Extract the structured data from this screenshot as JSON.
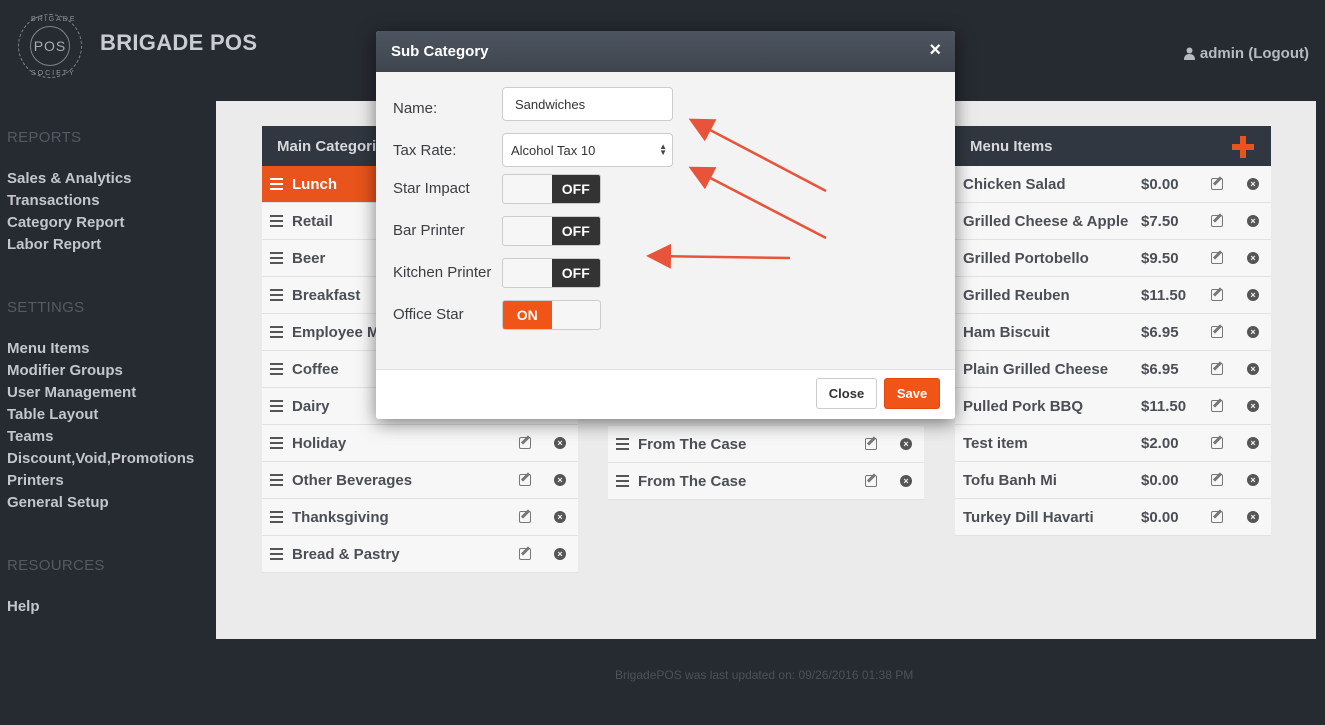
{
  "header": {
    "logo_text": "POS",
    "logo_ring_top": "BRIGADE",
    "logo_ring_bottom": "SOCIETY",
    "brand": "BRIGADE POS",
    "user": "admin (Logout)"
  },
  "sidebar": {
    "reports_title": "REPORTS",
    "reports": [
      "Sales & Analytics",
      "Transactions",
      "Category Report",
      "Labor Report"
    ],
    "settings_title": "SETTINGS",
    "settings": [
      "Menu Items",
      "Modifier Groups",
      "User Management",
      "Table Layout",
      "Teams",
      "Discount,Void,Promotions",
      "Printers",
      "General Setup"
    ],
    "resources_title": "RESOURCES",
    "resources": [
      "Help"
    ]
  },
  "main_categories": {
    "title": "Main Categories",
    "items": [
      "Lunch",
      "Retail",
      "Beer",
      "Breakfast",
      "Employee M",
      "Coffee",
      "Dairy",
      "Holiday",
      "Other Beverages",
      "Thanksgiving",
      "Bread & Pastry"
    ],
    "active_index": 0
  },
  "sub_categories": {
    "items": [
      "From The Case",
      "From The Case"
    ]
  },
  "menu_items": {
    "title": "Menu Items",
    "items": [
      {
        "name": "Chicken Salad",
        "price": "$0.00"
      },
      {
        "name": "Grilled Cheese & Apple",
        "price": "$7.50"
      },
      {
        "name": "Grilled Portobello",
        "price": "$9.50"
      },
      {
        "name": "Grilled Reuben",
        "price": "$11.50"
      },
      {
        "name": "Ham Biscuit",
        "price": "$6.95"
      },
      {
        "name": "Plain Grilled Cheese",
        "price": "$6.95"
      },
      {
        "name": "Pulled Pork BBQ",
        "price": "$11.50"
      },
      {
        "name": "Test item",
        "price": "$2.00"
      },
      {
        "name": "Tofu Banh Mi",
        "price": "$0.00"
      },
      {
        "name": "Turkey Dill Havarti",
        "price": "$0.00"
      }
    ]
  },
  "footer": {
    "note": "BrigadePOS was last updated on: 09/26/2016 01:38 PM"
  },
  "modal": {
    "title": "Sub Category",
    "close_glyph": "×",
    "name_label": "Name:",
    "name_value": "Sandwiches",
    "tax_label": "Tax Rate:",
    "tax_value": "Alcohol Tax 10",
    "toggles": [
      {
        "label": "Star Impact",
        "state": "OFF"
      },
      {
        "label": "Bar Printer",
        "state": "OFF"
      },
      {
        "label": "Kitchen Printer",
        "state": "OFF"
      },
      {
        "label": "Office Star",
        "state": "ON"
      }
    ],
    "close_label": "Close",
    "save_label": "Save"
  },
  "colors": {
    "accent": "#f05416",
    "header_dark": "#303740",
    "background": "#262a31"
  }
}
